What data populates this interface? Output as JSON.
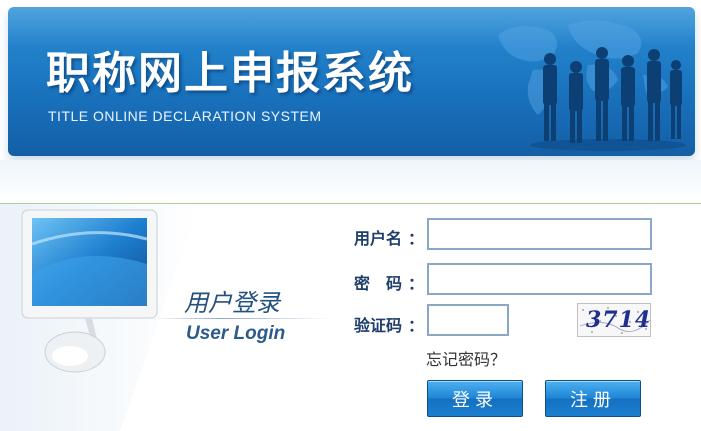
{
  "banner": {
    "title_zh": "职称网上申报系统",
    "title_en": "TITLE ONLINE DECLARATION SYSTEM"
  },
  "login_panel": {
    "title_zh": "用户登录",
    "title_en": "User Login"
  },
  "form": {
    "username_label": "用户名",
    "password_label": "密　码",
    "captcha_label": "验证码",
    "colon": "：",
    "username_value": "",
    "password_value": "",
    "captcha_value": "",
    "captcha_image_text": "3714",
    "forgot_password": "忘记密码？",
    "login_button": "登录",
    "register_button": "注册"
  },
  "colors": {
    "banner_blue": "#1a73be",
    "label_text": "#1f3e6a",
    "button_blue": "#1f86d6",
    "divider_green": "#a9cf98"
  }
}
